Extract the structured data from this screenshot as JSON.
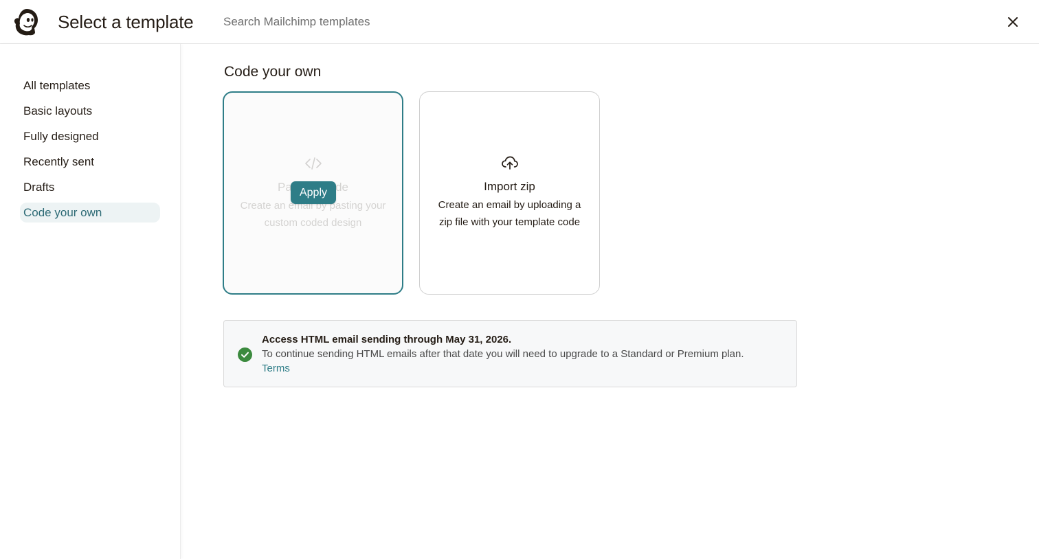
{
  "header": {
    "title": "Select a template",
    "search_placeholder": "Search Mailchimp templates",
    "search_value": ""
  },
  "sidebar": {
    "items": [
      {
        "label": "All templates",
        "active": false
      },
      {
        "label": "Basic layouts",
        "active": false
      },
      {
        "label": "Fully designed",
        "active": false
      },
      {
        "label": "Recently sent",
        "active": false
      },
      {
        "label": "Drafts",
        "active": false
      },
      {
        "label": "Code your own",
        "active": true
      }
    ]
  },
  "main": {
    "section_title": "Code your own",
    "cards": [
      {
        "icon": "code-icon",
        "title": "Paste in code",
        "description": "Create an email by pasting your custom coded design",
        "hover_button": "Apply",
        "selected": true
      },
      {
        "icon": "cloud-upload-icon",
        "title": "Import zip",
        "description": "Create an email by uploading a zip file with your template code",
        "selected": false
      }
    ]
  },
  "notice": {
    "icon": "check-circle-icon",
    "title": "Access HTML email sending through May 31, 2026.",
    "body": "To continue sending HTML emails after that date you will need to upgrade to a Standard or Premium plan.",
    "link": "Terms"
  },
  "colors": {
    "accent": "#2e7d87",
    "active_nav_bg": "#edf3f4",
    "success": "#3b8a3e",
    "text": "#241c15"
  }
}
